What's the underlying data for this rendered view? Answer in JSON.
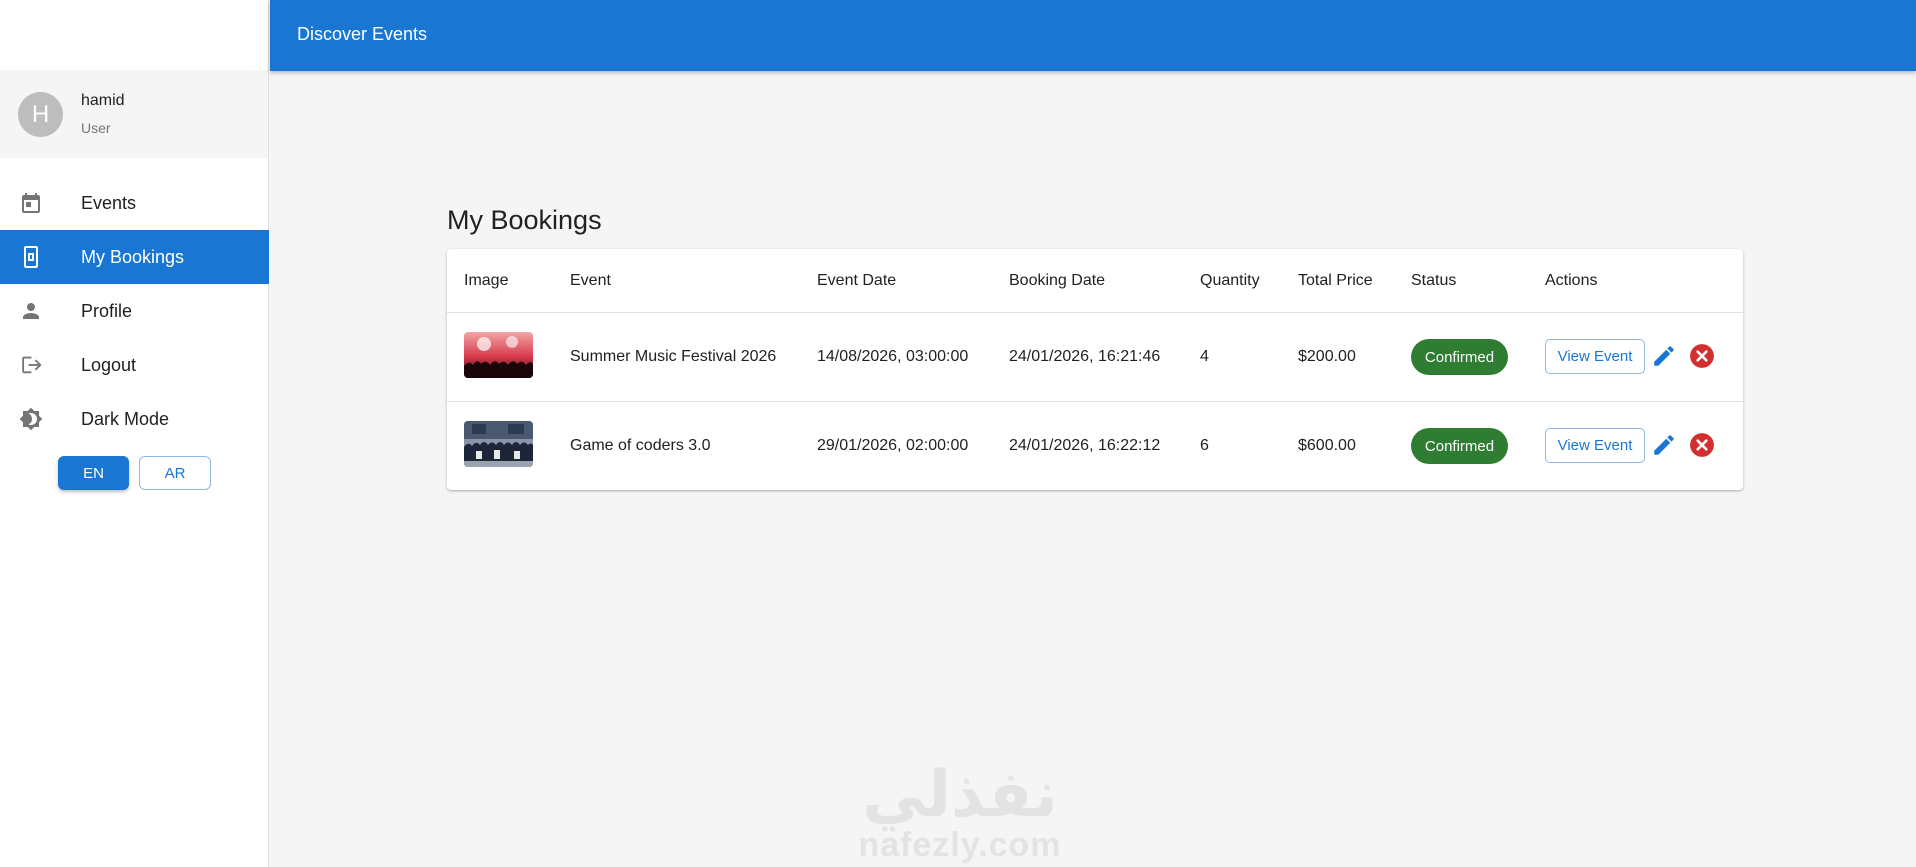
{
  "appbar": {
    "title": "Discover Events"
  },
  "user": {
    "initial": "H",
    "name": "hamid",
    "role": "User"
  },
  "nav": {
    "items": [
      {
        "label": "Events",
        "icon": "calendar-icon",
        "active": false
      },
      {
        "label": "My Bookings",
        "icon": "ticket-icon",
        "active": true
      },
      {
        "label": "Profile",
        "icon": "person-icon",
        "active": false
      },
      {
        "label": "Logout",
        "icon": "logout-icon",
        "active": false
      },
      {
        "label": "Dark Mode",
        "icon": "brightness-icon",
        "active": false
      }
    ]
  },
  "language": {
    "en": "EN",
    "ar": "AR",
    "selected": "EN"
  },
  "page": {
    "title": "My Bookings"
  },
  "table": {
    "headers": [
      "Image",
      "Event",
      "Event Date",
      "Booking Date",
      "Quantity",
      "Total Price",
      "Status",
      "Actions"
    ],
    "rows": [
      {
        "image": "concert-crowd-thumbnail",
        "event": "Summer Music Festival 2026",
        "event_date": "14/08/2026, 03:00:00",
        "booking_date": "24/01/2026, 16:21:46",
        "quantity": "4",
        "total_price": "$200.00",
        "status": "Confirmed",
        "view_label": "View Event"
      },
      {
        "image": "group-photo-thumbnail",
        "event": "Game of coders 3.0",
        "event_date": "29/01/2026, 02:00:00",
        "booking_date": "24/01/2026, 16:22:12",
        "quantity": "6",
        "total_price": "$600.00",
        "status": "Confirmed",
        "view_label": "View Event"
      }
    ]
  },
  "colors": {
    "primary": "#1976d2",
    "confirmed": "#2e7d32",
    "cancel": "#d32f2f"
  },
  "watermark": {
    "arabic": "نفذلي",
    "latin": "nafezly.com"
  }
}
